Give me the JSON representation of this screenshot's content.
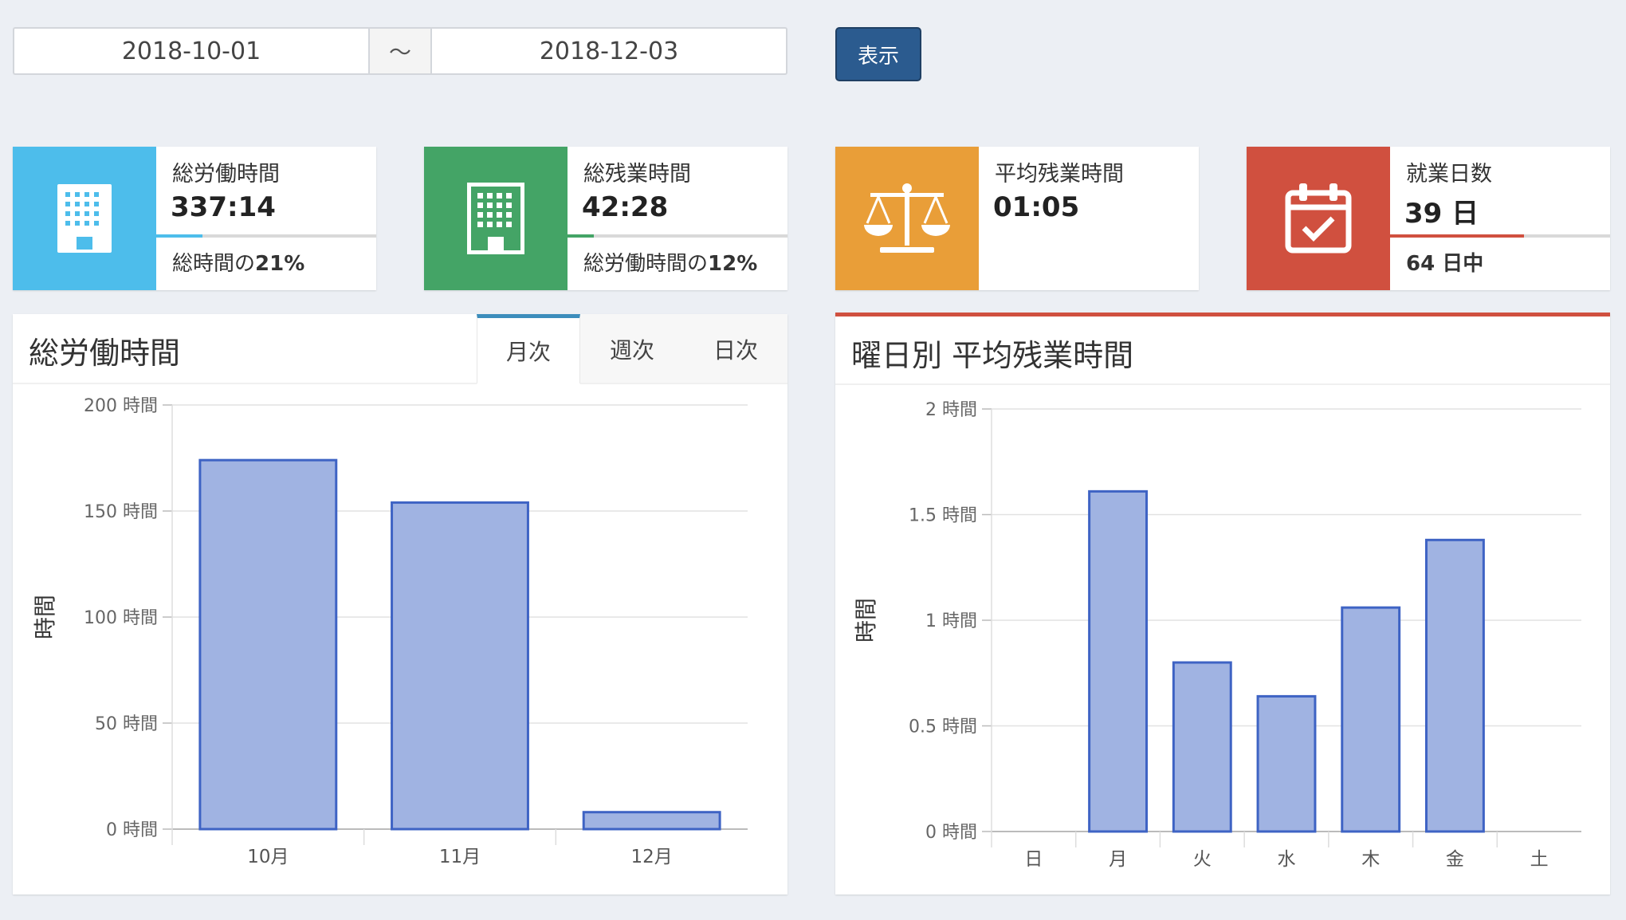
{
  "filter": {
    "date_from": "2018-10-01",
    "separator": "〜",
    "date_to": "2018-12-03",
    "show_button": "表示"
  },
  "stats": [
    {
      "label": "総労働時間",
      "value": "337:14",
      "desc_prefix": "総時間の",
      "desc_strong": "21%",
      "color": "#4dbdeb",
      "icon": "office-building-icon",
      "progress_percent": 21
    },
    {
      "label": "総残業時間",
      "value": "42:28",
      "desc_prefix": "総労働時間の",
      "desc_strong": "12%",
      "color": "#44a466",
      "icon": "office-building-icon",
      "progress_percent": 12
    },
    {
      "label": "平均残業時間",
      "value": "01:05",
      "desc_prefix": "",
      "desc_strong": "",
      "color": "#e99e38",
      "icon": "balance-scale-icon",
      "progress_percent": 0
    },
    {
      "label": "就業日数",
      "value": "39 日",
      "desc_prefix": "",
      "desc_strong": "64 日中",
      "color": "#d0503f",
      "icon": "calendar-check-icon",
      "progress_percent": 61
    }
  ],
  "left_panel": {
    "title": "総労働時間",
    "tabs": [
      "月次",
      "週次",
      "日次"
    ],
    "active_tab": "月次"
  },
  "right_panel": {
    "title": "曜日別 平均残業時間"
  },
  "chart_data": [
    {
      "type": "bar",
      "categories": [
        "10月",
        "11月",
        "12月"
      ],
      "values": [
        174,
        154,
        8
      ],
      "ylabel": "時間",
      "ylim": [
        0,
        200
      ],
      "yticks": [
        0,
        50,
        100,
        150,
        200
      ],
      "ytick_labels": [
        "0 時間",
        "50 時間",
        "100 時間",
        "150 時間",
        "200 時間"
      ],
      "bar_color": "#a0b3e2",
      "bar_border": "#3e63c4",
      "grid": true
    },
    {
      "type": "bar",
      "categories": [
        "日",
        "月",
        "火",
        "水",
        "木",
        "金",
        "土"
      ],
      "values": [
        0,
        1.61,
        0.8,
        0.64,
        1.06,
        1.38,
        0
      ],
      "ylabel": "時間",
      "ylim": [
        0,
        2
      ],
      "yticks": [
        0,
        0.5,
        1,
        1.5,
        2
      ],
      "ytick_labels": [
        "0 時間",
        "0.5 時間",
        "1 時間",
        "1.5 時間",
        "2 時間"
      ],
      "bar_color": "#a0b3e2",
      "bar_border": "#3e63c4",
      "grid": true
    }
  ]
}
